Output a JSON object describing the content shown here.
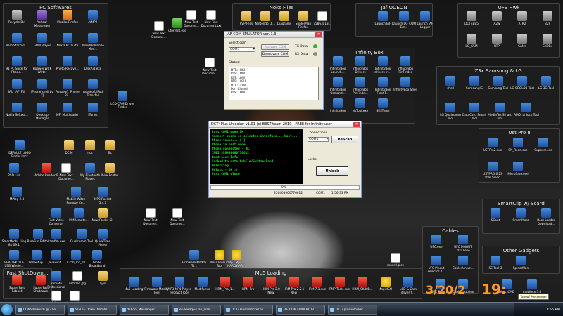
{
  "fences": {
    "pc_softwares": "PC Softwares",
    "noks_files": "Noks Files",
    "jaf_odeon": "Jaf ODEON",
    "ufs_hwk": "UFS Hwk",
    "infinity_box": "Infinity Box",
    "z3x": "Z3x Samsung & LG",
    "ust_pro": "Ust Pro II",
    "smartclip": "SmartClip w/ Scard",
    "cables": "Cables",
    "other_gadgets": "Other Gadgets",
    "fast_shutdown": "Fast ShutDown...",
    "mp5_loading": "Mp5 Loading"
  },
  "pc_icons": [
    {
      "label": "Recycle Bin",
      "icon": "recycle-bin-icon"
    },
    {
      "label": "Yahoo! Messenger",
      "icon": "yahoo-icon"
    },
    {
      "label": "Mozilla Firefox",
      "icon": "firefox-icon"
    },
    {
      "label": "AIMP2",
      "icon": "aimp-icon"
    },
    {
      "label": "Nero StartSm...",
      "icon": "nero-icon"
    },
    {
      "label": "GOM Player",
      "icon": "gom-icon"
    },
    {
      "label": "Nokia PC Suite",
      "icon": "nokia-icon"
    },
    {
      "label": "MobiMB Mobile Med...",
      "icon": "mobimb-icon"
    },
    {
      "label": "91 PC Suite for iPhone...",
      "icon": "91pc-icon"
    },
    {
      "label": "Huawei WCK Writer",
      "icon": "huawei-icon"
    },
    {
      "label": "Photo Recove...",
      "icon": "photo-icon"
    },
    {
      "label": "DiskAid.exe",
      "icon": "diskaid-icon"
    },
    {
      "label": "JAU_JAF_FW",
      "icon": "jau-icon"
    },
    {
      "label": "iPhone shell by XJ",
      "icon": "iphone-shell-icon"
    },
    {
      "label": "Assoeoft iPhone Ri...",
      "icon": "assoeoft-icon"
    },
    {
      "label": "Assoeoft iPod Transfer",
      "icon": "ipod-icon"
    },
    {
      "label": "Nokia Softwa...",
      "icon": "nokia-software-icon"
    },
    {
      "label": "Desktop Manager",
      "icon": "desktop-manager-icon"
    },
    {
      "label": "MFI Multiloader",
      "icon": "mfi-icon"
    },
    {
      "label": "iTunes",
      "icon": "itunes-icon"
    }
  ],
  "noks_icons": [
    {
      "label": "PVP Files",
      "icon": "folder-icon"
    },
    {
      "label": "Nintendo Di...",
      "icon": "folder-icon"
    },
    {
      "label": "Diagrams",
      "icon": "folder-icon"
    },
    {
      "label": "SpiderMan Firefox",
      "icon": "folder-icon"
    },
    {
      "label": "75863013...",
      "icon": "file-icon"
    }
  ],
  "desk_top_icons": [
    {
      "label": "New Text Docume...",
      "icon": "text-doc-icon"
    },
    {
      "label": "New Text Document.txt",
      "icon": "text-doc-icon"
    },
    {
      "label": "New Text Docume...",
      "icon": "text-doc-icon"
    },
    {
      "label": "utorrent.exe",
      "icon": "utorrent-icon"
    },
    {
      "label": "New Text Docume...",
      "icon": "text-doc-icon"
    }
  ],
  "jaf_icons": [
    {
      "label": "Launch JAF",
      "icon": "jaf-icon"
    },
    {
      "label": "Launch JAF COM Em...",
      "icon": "jaf-icon"
    },
    {
      "label": "Launch JAF Logger",
      "icon": "jaf-icon"
    }
  ],
  "ufs_icons": [
    {
      "label": "DCT4BB5",
      "icon": "ufs-icon"
    },
    {
      "label": "A2w",
      "icon": "ufs-icon"
    },
    {
      "label": "ATR2",
      "icon": "ufs-icon"
    },
    {
      "label": "B2F",
      "icon": "ufs-icon"
    },
    {
      "label": "LG_GSM",
      "icon": "ufs-icon"
    },
    {
      "label": "RTP",
      "icon": "ufs-icon"
    },
    {
      "label": "SAMs",
      "icon": "ufs-icon"
    },
    {
      "label": "SeDBx",
      "icon": "ufs-icon"
    }
  ],
  "infinity_icons": [
    {
      "label": "InfinityBox Launch...",
      "icon": "infinity-icon"
    },
    {
      "label": "InfinityBox Drivers",
      "icon": "infinity-icon"
    },
    {
      "label": "InfinityBox drivers in...",
      "icon": "infinity-icon"
    },
    {
      "label": "InfinityBox PinFinder",
      "icon": "infinity-icon"
    },
    {
      "label": "InfinityBox Ucmand...",
      "icon": "infinity-icon"
    },
    {
      "label": "InfinityBox PinFinde...",
      "icon": "infinity-icon"
    },
    {
      "label": "InfinityBox FlashT...",
      "icon": "infinity-icon"
    },
    {
      "label": "InfinityBox Shell",
      "icon": "infinity-icon"
    },
    {
      "label": "InfinityBox",
      "icon": "infinity-icon"
    },
    {
      "label": "NkTool.exe",
      "icon": "infinity-icon"
    },
    {
      "label": "BEST.exe",
      "icon": "infinity-icon"
    }
  ],
  "z3x_icons": [
    {
      "label": "shell",
      "icon": "z3x-icon"
    },
    {
      "label": "SamsungIG",
      "icon": "z3x-icon"
    },
    {
      "label": "Samsung Tool",
      "icon": "z3x-icon"
    },
    {
      "label": "LG SGOLD3 Tool",
      "icon": "z3x-icon"
    },
    {
      "label": "LG 3G Tool",
      "icon": "z3x-icon"
    },
    {
      "label": "LG Qualcomm Tool",
      "icon": "z3x-icon"
    },
    {
      "label": "DataCard Smart Tool",
      "icon": "z3x-icon"
    },
    {
      "label": "MediaTek Smart Tool",
      "icon": "z3x-icon"
    },
    {
      "label": "AMOI unlock Tool",
      "icon": "z3x-icon"
    }
  ],
  "ust_icons": [
    {
      "label": "USTPro2.exe",
      "icon": "ust-icon"
    },
    {
      "label": "SN_Read.exe",
      "icon": "ust-icon"
    },
    {
      "label": "Support.exe",
      "icon": "ust-icon"
    },
    {
      "label": "USTPRO 6.23 Cable Selec...",
      "icon": "ust-icon"
    },
    {
      "label": "MicroSam.exe",
      "icon": "ust-icon"
    }
  ],
  "smartclip_icons": [
    {
      "label": "SCout",
      "icon": "smartclip-icon"
    },
    {
      "label": "SmartMoto",
      "icon": "smartclip-icon"
    },
    {
      "label": "Boot-Loader Download...",
      "icon": "smartclip-icon"
    }
  ],
  "cables_icons": [
    {
      "label": "UFC.exe",
      "icon": "cable-icon"
    },
    {
      "label": "UFC PINOUT 2010.exe",
      "icon": "cable-icon"
    },
    {
      "label": "UFC Pinout selector 4...",
      "icon": "cable-icon"
    },
    {
      "label": "CablesUnive...",
      "icon": "cable-icon"
    }
  ],
  "gadgets_icons": [
    {
      "label": "SE Tool 3",
      "icon": "gadget-icon"
    },
    {
      "label": "SpiderMan",
      "icon": "gadget-icon"
    }
  ],
  "left_icons": [
    {
      "label": "LCD-CAM Driver Finder",
      "icon": "lcd-cam-icon"
    },
    {
      "label": "DEFAULT LOGO Finder Lock",
      "icon": "logo-icon"
    },
    {
      "label": "DCIM",
      "icon": "folder-icon"
    },
    {
      "label": "ncs",
      "icon": "folder-icon"
    },
    {
      "label": "Trc",
      "icon": "folder-icon"
    },
    {
      "label": "RSD Lite",
      "icon": "rsd-icon"
    },
    {
      "label": "Adobe Reader 9",
      "icon": "adobe-icon"
    },
    {
      "label": "New Text Docume...",
      "icon": "text-doc-icon"
    },
    {
      "label": "My Bluetooth Places",
      "icon": "bluetooth-icon"
    },
    {
      "label": "New Folder",
      "icon": "folder-icon"
    },
    {
      "label": "MPlog 2.3",
      "icon": "mplog-icon"
    },
    {
      "label": "Mobile Witch Remote Co...",
      "icon": "mobile-witch-icon"
    },
    {
      "label": "MP3 Rocket 5.4.1",
      "icon": "mp3rocket-icon"
    },
    {
      "label": "Fast Video Converter",
      "icon": "video-icon"
    },
    {
      "label": "MMRemote...",
      "icon": "mmremote-icon"
    },
    {
      "label": "New Folder (2)",
      "icon": "folder-icon"
    },
    {
      "label": "New Text Docume...",
      "icon": "text-doc-icon"
    },
    {
      "label": "New Text Docume...",
      "icon": "text-doc-icon"
    },
    {
      "label": "SmartMobi.. ling 81.09.1",
      "icon": "smartmobi-icon"
    },
    {
      "label": "RaraFun Editor",
      "icon": "rarafun-icon"
    },
    {
      "label": "itamfim.exe",
      "icon": "itam-icon"
    },
    {
      "label": "Qualcomm Tool",
      "icon": "qualcomm-icon"
    },
    {
      "label": "QuickTime Player",
      "icon": "quicktime-icon"
    },
    {
      "label": "REALTEK 11n USB Wirele...",
      "icon": "realtek-icon"
    },
    {
      "label": "WinSetup..",
      "icon": "winsetup-icon"
    },
    {
      "label": "javawinti...",
      "icon": "java-icon"
    },
    {
      "label": "k750_lcd_fill",
      "icon": "k750-icon"
    },
    {
      "label": "Globe Broadband",
      "icon": "globe-icon"
    },
    {
      "label": "Firmware Modify To...",
      "icon": "firmware-icon"
    },
    {
      "label": "Mess Product Tool",
      "icon": "mess-icon"
    },
    {
      "label": "Mp3.Mp4... HARDWAR...",
      "icon": "mp3mp4-icon"
    },
    {
      "label": "Remote Professional",
      "icon": "remote-icon"
    },
    {
      "label": "untitled.jpg",
      "icon": "image-icon"
    },
    {
      "label": "ayio",
      "icon": "folder-icon"
    },
    {
      "label": "maxell.pics",
      "icon": "image-icon"
    },
    {
      "label": "k2 1.jpg",
      "icon": "image-icon"
    },
    {
      "label": "images.jpg",
      "icon": "image-icon"
    }
  ],
  "fast_shutdown_icons": [
    {
      "label": "Super Fast Reboot",
      "icon": "reboot-icon"
    },
    {
      "label": "Super Fast Shutdown",
      "icon": "shutdown-icon"
    }
  ],
  "mp5_icons": [
    {
      "label": "Mp5 Loading",
      "icon": "mp5-icon"
    },
    {
      "label": "Firmware Modify Tool",
      "icon": "mp5-icon"
    },
    {
      "label": "MP3 MP4 Player Product Tool",
      "icon": "mp5-icon"
    },
    {
      "label": "Modify.exe",
      "icon": "mp5-icon"
    },
    {
      "label": "HRM_Pro_1...",
      "icon": "hrm-icon"
    },
    {
      "label": "HRM Pro",
      "icon": "hrm-icon"
    },
    {
      "label": "HRM Pro 2.0 New",
      "icon": "hrm-icon"
    },
    {
      "label": "HRM Pro 2.2.1 New",
      "icon": "hrm-icon"
    },
    {
      "label": "HRM 7.1.exe",
      "icon": "hrm-icon"
    },
    {
      "label": "PMP Tools.exe",
      "icon": "hrm-icon"
    },
    {
      "label": "HRM_SK88B...",
      "icon": "hrm-icon"
    },
    {
      "label": "MagicISO",
      "icon": "magiciso-icon"
    },
    {
      "label": "LCD & Cam driver fi...",
      "icon": "lcd-icon"
    }
  ],
  "right_bottom_icons": [
    {
      "label": "UFC Select...",
      "icon": "ufc-icon"
    },
    {
      "label": "Cable List.xlsx",
      "icon": "xlsx-icon"
    },
    {
      "label": "DirectCMD",
      "icon": "directcmd-icon"
    },
    {
      "label": "mobiletx 3.4",
      "icon": "mobiletx-icon"
    }
  ],
  "jaf_window": {
    "title": "JAF COM EMULATOR ver. 1.3",
    "select_com": "Select com :",
    "com_value": "COM1",
    "activate_btn": "Activate COM",
    "deactivate_btn": "Deactivate COM",
    "tx_label": "TX Data",
    "rx_label": "RX Data",
    "status_label": "Status:",
    "status_lines": [
      "DTR: HIGH",
      "RTS: LOW",
      "RTS: LOW",
      "RTS: HIGH",
      "DTR: LOW",
      "Port Closed",
      "RTS: LOW"
    ],
    "tx_color": "#2db82d",
    "rx_color": "#888888"
  },
  "dct_window": {
    "title": "DCT4Plus Unlocker v1.01 (c) BEST team 2010 - FREE for Infinity user",
    "console_lines": [
      "Port COM1 open OK",
      "Connect phone on selected interface... Wait...",
      "Phone found... [ ]",
      "Phone in Test mode",
      "Phone connected - OK",
      "IMEI 356408900776612",
      "Read Lock Info",
      "Locked to data Mobile/Switzerland",
      "Unlocking...",
      "Unlock - Ok :)",
      "Port COM1 close"
    ],
    "connections_label": "Connections",
    "connection_value": "COM1",
    "rescan_btn": "ReScan",
    "locks_label": "Locks",
    "unlock_btn": "Unlock",
    "progress": "0%",
    "status_imei": "356408900776612",
    "status_com": "COM1",
    "status_time": "1:56:33 PM"
  },
  "desktop_clock": {
    "date": "3/20/2",
    "time": "19:"
  },
  "tooltip": "Yahoo! Messenger",
  "taskbar": {
    "tasks": [
      "COMSandwich @ - Se...",
      "SG10 - DownThemAll",
      "Yahoo! Messenger",
      "ex-Saraqo-Lian_Lian...",
      "DCT4PlusUnlocker.ex...",
      "JAF COM EMULATOR...",
      "DCT4plusunlocker"
    ],
    "clock": "1:56 PM"
  }
}
